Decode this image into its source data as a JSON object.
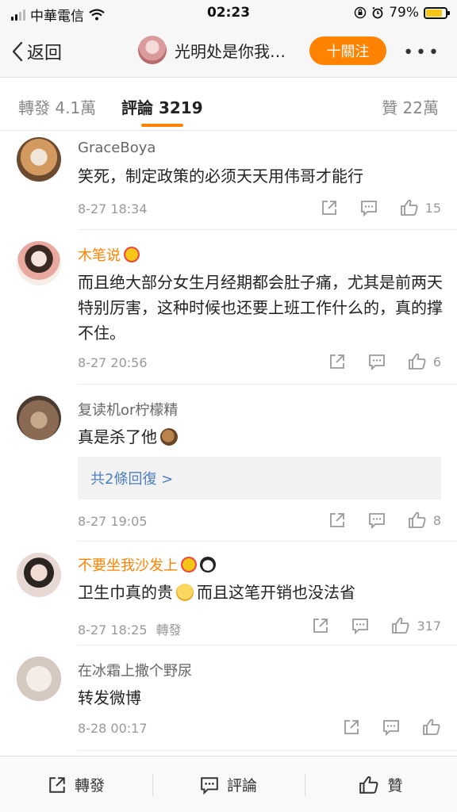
{
  "status_bar": {
    "carrier": "中華電信",
    "time": "02:23",
    "battery": "79%",
    "battery_level": 0.79
  },
  "nav": {
    "back_label": "返回",
    "title": "光明处是你我…",
    "follow_label": "十關注",
    "more_label": "•••"
  },
  "tabs": {
    "repost": "轉發 4.1萬",
    "comments": "評論 3219",
    "likes": "贊 22萬"
  },
  "comments": [
    {
      "user": "GraceBoya",
      "text": "笑死，制定政策的必须天天用伟哥才能行",
      "time": "8-27 18:34",
      "likes": "15",
      "avatar_color": "#c9a07a"
    },
    {
      "user": "木笔说",
      "text": "而且绝大部分女生月经期都会肚子痛，尤其是前两天特别厉害，这种时候也还要上班工作什么的，真的撑不住。",
      "time": "8-27 20:56",
      "likes": "6",
      "avatar_color": "#d8c2b8"
    },
    {
      "user": "复读机or柠檬精",
      "text": "真是杀了他",
      "time": "8-27 19:05",
      "likes": "8",
      "reply_summary": "共2條回復 >",
      "avatar_color": "#8a6a52"
    },
    {
      "user": "不要坐我沙发上",
      "text_a": "卫生巾真的贵",
      "text_b": "而且这笔开销也没法省",
      "time": "8-27 18:25",
      "repost_tag": "轉發",
      "likes": "317",
      "avatar_color": "#e8d8d4"
    },
    {
      "user": "在冰霜上撒个野尿",
      "text": "转发微博",
      "time": "8-28 00:17",
      "likes": "",
      "avatar_color": "#d4c8c0"
    }
  ],
  "bottom_bar": {
    "repost": "轉發",
    "comment": "評論",
    "like": "贊"
  },
  "colors": {
    "accent": "#ff8200",
    "link": "#4d7fbf"
  }
}
